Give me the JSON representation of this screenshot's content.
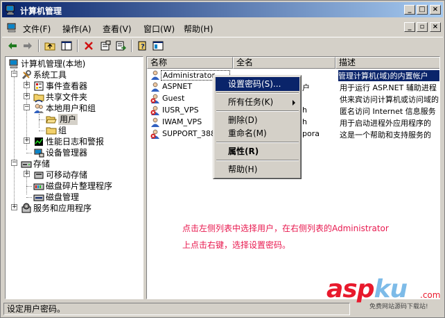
{
  "window": {
    "title": "计算机管理",
    "controls": {
      "minimize": "_",
      "maximize": "□",
      "close": "×"
    }
  },
  "menubar": {
    "items": [
      "文件(F)",
      "操作(A)",
      "查看(V)",
      "窗口(W)",
      "帮助(H)"
    ],
    "mdi_controls": {
      "minimize": "_",
      "restore": "▫",
      "close": "×"
    }
  },
  "toolbar": {
    "buttons": [
      "back-arrow-icon",
      "forward-arrow-icon",
      "up-folder-icon",
      "show-tree-icon",
      "delete-icon",
      "properties-icon",
      "export-list-icon",
      "help-icon",
      "console-tree-icon"
    ]
  },
  "tree": {
    "root": "计算机管理(本地)",
    "system_tools": "系统工具",
    "event_viewer": "事件查看器",
    "shared_folders": "共享文件夹",
    "local_users_groups": "本地用户和组",
    "users": "用户",
    "groups": "组",
    "perf_logs": "性能日志和警报",
    "device_manager": "设备管理器",
    "storage": "存储",
    "removable_storage": "可移动存储",
    "defrag": "磁盘碎片整理程序",
    "disk_management": "磁盘管理",
    "services_apps": "服务和应用程序"
  },
  "list": {
    "columns": [
      "名称",
      "全名",
      "描述"
    ],
    "rows": [
      {
        "name": "Administrator",
        "fullname": "",
        "desc": "管理计算机(域)的内置帐户"
      },
      {
        "name": "ASPNET",
        "fullname": "",
        "desc": "用于运行 ASP.NET 辅助进程"
      },
      {
        "name": "Guest",
        "fullname": "",
        "desc": "供来宾访问计算机或访问域的"
      },
      {
        "name": "IUSR_VPS",
        "fullname": "",
        "desc": "匿名访问 Internet 信息服务"
      },
      {
        "name": "IWAM_VPS",
        "fullname": "",
        "desc": "用于启动进程外应用程序的"
      },
      {
        "name": "SUPPORT_3889",
        "fullname": "porа",
        "desc": "这是一个帮助和支持服务的"
      }
    ],
    "partial_fullname": [
      "户",
      "h",
      "h",
      "h"
    ]
  },
  "context_menu": {
    "set_password": "设置密码(S)...",
    "all_tasks": "所有任务(K)",
    "delete": "删除(D)",
    "rename": "重命名(M)",
    "properties": "属性(R)",
    "help": "帮助(H)"
  },
  "annotation": {
    "line1": "点击左侧列表中选择用户，在右侧列表的Administrator",
    "line2": "上点击右键，选择设置密码。"
  },
  "watermark": {
    "asp": "asp",
    "ku": "ku",
    "com": ".com",
    "tagline": "免费网站源码下载站!"
  },
  "statusbar": {
    "text": "设定用户密码。"
  },
  "colors": {
    "titlebar_start": "#0a246a",
    "titlebar_end": "#a6caf0",
    "selection": "#0a246a",
    "annotation": "#e8194f",
    "chrome": "#d4d0c8"
  }
}
